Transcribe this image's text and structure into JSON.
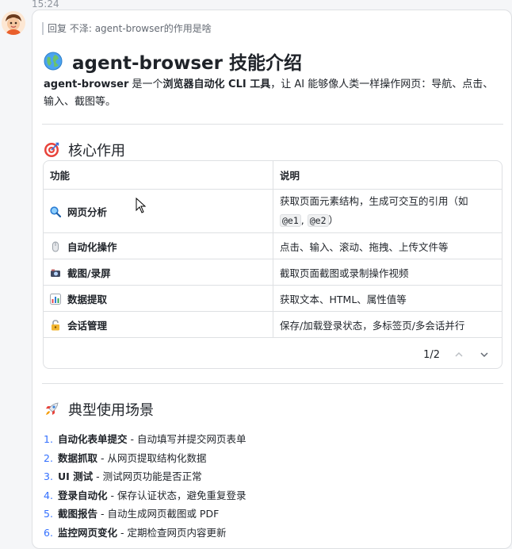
{
  "message_time": "15:24",
  "reply": {
    "prefix": "回复 不泽:",
    "quoted": "agent-browser的作用是啥"
  },
  "title": {
    "icon": "globe-icon",
    "text": "agent-browser 技能介绍"
  },
  "intro": {
    "name": "agent-browser",
    "part1": " 是一个",
    "highlight": "浏览器自动化 CLI 工具",
    "part2": "，让 AI 能够像人类一样操作网页：导航、点击、输入、截图等。"
  },
  "section_core": {
    "icon": "target-icon",
    "title": "核心作用"
  },
  "table": {
    "headers": [
      "功能",
      "说明"
    ],
    "rows": [
      {
        "icon": "magnifier-icon",
        "feature": "网页分析",
        "desc": "获取页面元素结构，生成可交互的引用（如 ",
        "code1": "@e1",
        "sep": ", ",
        "code2": "@e2",
        "tail": "）"
      },
      {
        "icon": "mouse-icon",
        "feature": "自动化操作",
        "desc": "点击、输入、滚动、拖拽、上传文件等"
      },
      {
        "icon": "camera-icon",
        "feature": "截图/录屏",
        "desc": "截取页面截图或录制操作视频"
      },
      {
        "icon": "bar-chart-icon",
        "feature": "数据提取",
        "desc": "获取文本、HTML、属性值等"
      },
      {
        "icon": "lock-icon",
        "feature": "会话管理",
        "desc": "保存/加载登录状态，多标签页/多会话并行"
      }
    ],
    "pager": "1/2"
  },
  "section_usecases": {
    "icon": "rocket-icon",
    "title": "典型使用场景"
  },
  "usecases": [
    {
      "num": "1.",
      "name": "自动化表单提交",
      "desc": " - 自动填写并提交网页表单"
    },
    {
      "num": "2.",
      "name": "数据抓取",
      "desc": " - 从网页提取结构化数据"
    },
    {
      "num": "3.",
      "name": "UI 测试",
      "desc": " - 测试网页功能是否正常"
    },
    {
      "num": "4.",
      "name": "登录自动化",
      "desc": " - 保存认证状态，避免重复登录"
    },
    {
      "num": "5.",
      "name": "截图报告",
      "desc": " - 自动生成网页截图或 PDF"
    },
    {
      "num": "6.",
      "name": "监控网页变化",
      "desc": " - 定期检查网页内容更新"
    }
  ]
}
